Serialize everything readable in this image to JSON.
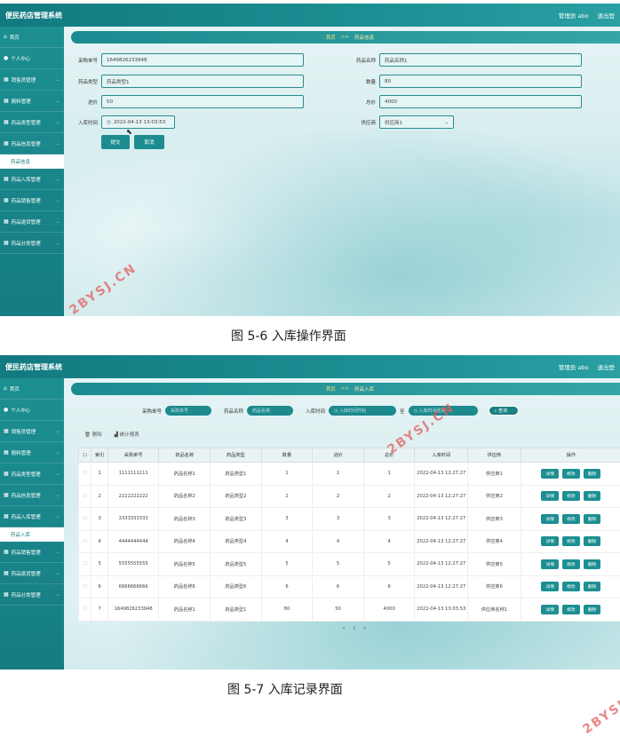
{
  "app_title": "便民药店管理系统",
  "user_label": "管理员 abo",
  "logout_label": "退出登",
  "screen1": {
    "sidebar": [
      {
        "label": "首页",
        "icon": "home-icon"
      },
      {
        "label": "个人中心",
        "icon": "user-icon"
      },
      {
        "label": "销售员管理",
        "icon": "grid-icon"
      },
      {
        "label": "厕料管理",
        "icon": "grid-icon"
      },
      {
        "label": "药品类型管理",
        "icon": "grid-icon"
      },
      {
        "label": "药品信息管理",
        "icon": "grid-icon"
      }
    ],
    "sidebar_sub": "药品信息",
    "sidebar2": [
      {
        "label": "药品入库管理",
        "icon": "grid-icon"
      },
      {
        "label": "药品销售管理",
        "icon": "grid-icon"
      },
      {
        "label": "药品退货管理",
        "icon": "grid-icon"
      },
      {
        "label": "药品分类管理",
        "icon": "grid-icon"
      }
    ],
    "breadcrumb": {
      "home": "首页",
      "sep": ">>",
      "current": "药品信息"
    },
    "form": {
      "purchase_no_label": "采购单号",
      "purchase_no": "1649826233948",
      "drug_name_label": "药品名称",
      "drug_name": "药品名称1",
      "drug_type_label": "药品类型",
      "drug_type": "药品类型1",
      "qty_label": "数量",
      "qty": "80",
      "price_label": "进价",
      "price": "50",
      "total_label": "总价",
      "total": "4000",
      "time_label": "入库时间",
      "time": "2022-04-13 13:03:53",
      "supplier_label": "供应商",
      "supplier": "供应商1",
      "submit": "提交",
      "cancel": "取消"
    }
  },
  "caption1": "图 5-6 入库操作界面",
  "screen2": {
    "sidebar": [
      {
        "label": "首页",
        "icon": "home-icon"
      },
      {
        "label": "个人中心",
        "icon": "user-icon"
      },
      {
        "label": "销售员管理",
        "icon": "grid-icon"
      },
      {
        "label": "厕料管理",
        "icon": "grid-icon"
      },
      {
        "label": "药品类型管理",
        "icon": "grid-icon"
      },
      {
        "label": "药品信息管理",
        "icon": "grid-icon"
      },
      {
        "label": "药品入库管理",
        "icon": "grid-icon"
      }
    ],
    "sidebar_sub": "药品入库",
    "sidebar2": [
      {
        "label": "药品销售管理",
        "icon": "grid-icon"
      },
      {
        "label": "药品退货管理",
        "icon": "grid-icon"
      },
      {
        "label": "药品分类管理",
        "icon": "grid-icon"
      }
    ],
    "breadcrumb": {
      "home": "首页",
      "sep": ">>",
      "current": "药品入库"
    },
    "search": {
      "purchase_no_label": "采购单号",
      "purchase_no_ph": "采购单号",
      "drug_name_label": "药品名称",
      "drug_name_ph": "药品名称",
      "time_label": "入库时间",
      "time_start_ph": "入库时间开始",
      "time_to": "至",
      "time_end_ph": "入库时间结束",
      "search_btn": "查询"
    },
    "actions": {
      "delete": "删除",
      "stats": "统计报表"
    },
    "columns": [
      "索引",
      "采购单号",
      "药品名称",
      "药品类型",
      "数量",
      "进价",
      "总价",
      "入库时间",
      "供应商",
      "操作"
    ],
    "rows": [
      [
        "1",
        "1111111111",
        "药品名称1",
        "药品类型1",
        "1",
        "1",
        "1",
        "2022-04-13 12:27:27",
        "供应商1"
      ],
      [
        "2",
        "2222222222",
        "药品名称2",
        "药品类型2",
        "2",
        "2",
        "2",
        "2022-04-13 12:27:27",
        "供应商2"
      ],
      [
        "3",
        "3333333333",
        "药品名称3",
        "药品类型3",
        "3",
        "3",
        "3",
        "2022-04-13 12:27:27",
        "供应商3"
      ],
      [
        "4",
        "4444444444",
        "药品名称4",
        "药品类型4",
        "4",
        "4",
        "4",
        "2022-04-13 12:27:27",
        "供应商4"
      ],
      [
        "5",
        "5555555555",
        "药品名称5",
        "药品类型5",
        "5",
        "5",
        "5",
        "2022-04-13 12:27:27",
        "供应商5"
      ],
      [
        "6",
        "6666666666",
        "药品名称6",
        "药品类型6",
        "6",
        "6",
        "6",
        "2022-04-13 12:27:27",
        "供应商6"
      ],
      [
        "7",
        "1649826233948",
        "药品名称1",
        "药品类型1",
        "80",
        "50",
        "4000",
        "2022-04-13 13:03:53",
        "供应商名称1"
      ]
    ],
    "row_ops": [
      "详情",
      "修改",
      "删除"
    ],
    "pager": {
      "prev": "<",
      "page": "1",
      "next": ">"
    }
  },
  "caption2": "图 5-7 入库记录界面",
  "watermark": "2BYSJ.CN"
}
